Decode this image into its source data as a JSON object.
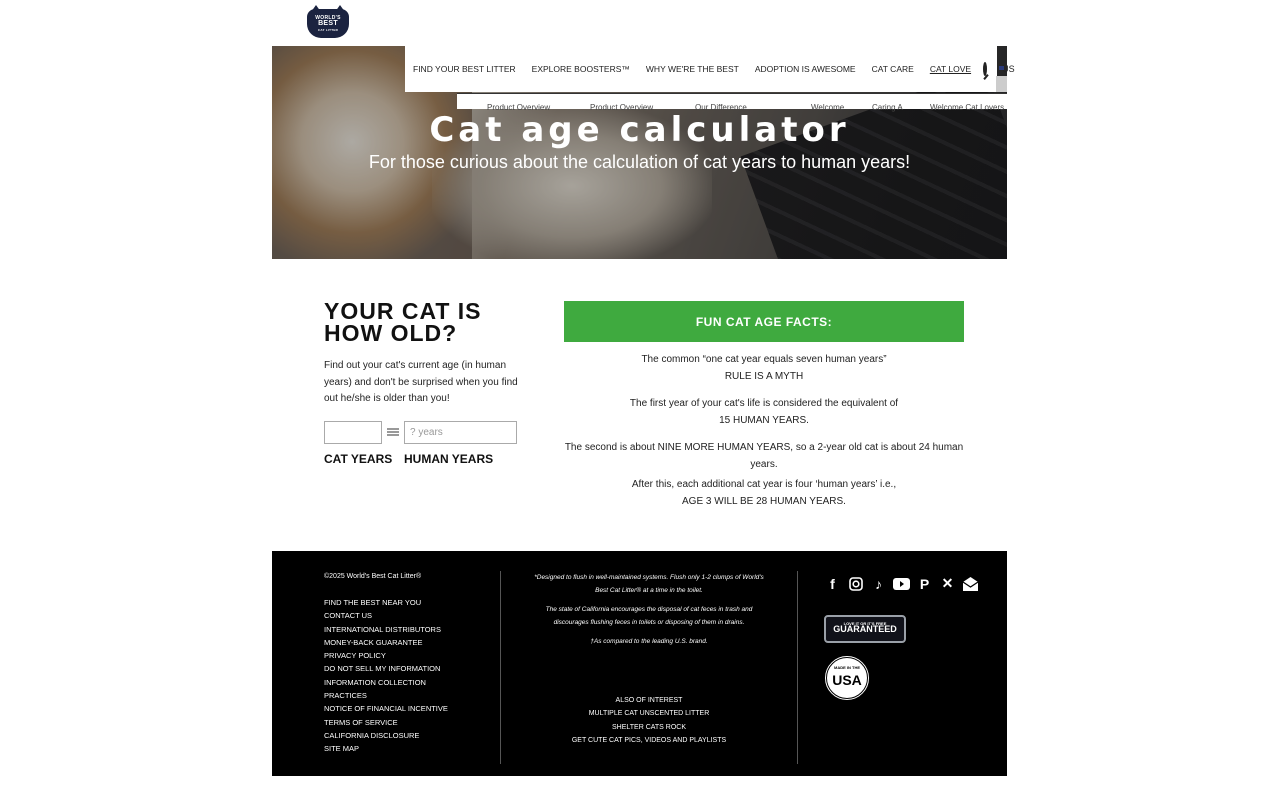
{
  "logo": {
    "line1": "WORLD'S",
    "line2": "BEST",
    "line3": "CAT LITTER"
  },
  "nav": {
    "items": [
      "FIND YOUR BEST LITTER",
      "EXPLORE BOOSTERS™",
      "WHY WE'RE THE BEST",
      "ADOPTION IS AWESOME",
      "CAT CARE",
      "CAT LOVE"
    ],
    "lang": "US"
  },
  "subnav": [
    "Product Overview",
    "Product Overview",
    "Our Difference",
    "Welcome",
    "Caring A",
    "Welcome Cat Lovers"
  ],
  "hero": {
    "title": "Cat age calculator",
    "subtitle": "For those curious about the calculation of cat years to human years!"
  },
  "calculator": {
    "heading": "YOUR CAT IS HOW OLD?",
    "description": "Find out your cat's current age (in human years) and don't be surprised when you find out he/she is older than you!",
    "cat_value": "",
    "human_placeholder": "? years",
    "cat_label": "CAT YEARS",
    "human_label": "HUMAN YEARS"
  },
  "facts": {
    "heading": "FUN CAT AGE FACTS:",
    "f1a": "The common “one cat year equals seven human years”",
    "f1b": "RULE IS A MYTH",
    "f2a": "The first year of your cat's life is considered the equivalent of",
    "f2b": "15 HUMAN YEARS.",
    "f3a": "The second is about ",
    "f3b": "NINE MORE HUMAN YEARS,",
    "f3c": " so a 2-year old cat is about 24 human years.",
    "f4a": "After this, each additional cat year is four ‘human years’ i.e.,",
    "f4b": "AGE 3 WILL BE 28 HUMAN YEARS."
  },
  "footer": {
    "copyright": "©2025 World's Best Cat Litter®",
    "links": [
      "FIND THE BEST NEAR YOU",
      "CONTACT US",
      "INTERNATIONAL DISTRIBUTORS",
      "MONEY-BACK GUARANTEE",
      "PRIVACY POLICY",
      "DO NOT SELL MY INFORMATION",
      "INFORMATION COLLECTION",
      "PRACTICES",
      "NOTICE OF FINANCIAL INCENTIVE",
      "TERMS OF SERVICE",
      "CALIFORNIA DISCLOSURE",
      "SITE MAP"
    ],
    "note1": "*Designed to flush in well-maintained systems. Flush only 1-2 clumps of World's Best Cat Litter® at a time in the toilet.",
    "note2": "The state of California encourages the disposal of cat feces in trash and discourages flushing feces in toilets or disposing of them in drains.",
    "note3": "†As compared to the leading U.S. brand.",
    "interest_heading": "ALSO OF INTEREST",
    "interest": [
      "MULTIPLE CAT UNSCENTED LITTER",
      "SHELTER CATS ROCK",
      "GET CUTE CAT PICS, VIDEOS AND PLAYLISTS"
    ],
    "social_icons": [
      "facebook-icon",
      "instagram-icon",
      "tiktok-icon",
      "youtube-icon",
      "pinterest-icon",
      "x-icon",
      "email-icon"
    ],
    "badge_guarantee_small": "LOVE IT OR IT'S FREE",
    "badge_guarantee": "GUARANTEED",
    "badge_usa_small": "MADE IN THE",
    "badge_usa": "USA"
  },
  "colors": {
    "accent": "#3faa3f",
    "navy": "#1b2340",
    "footer": "#000000"
  }
}
